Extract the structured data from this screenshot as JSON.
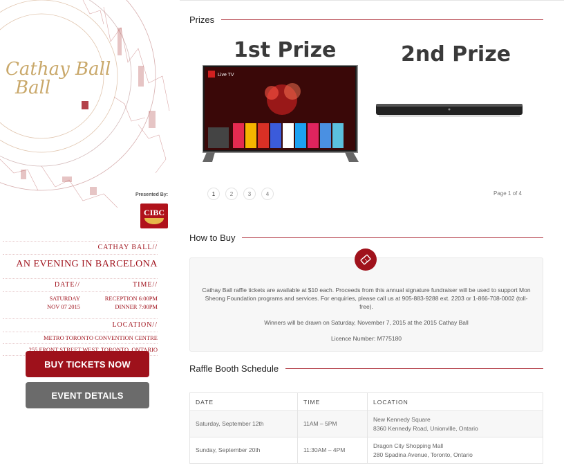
{
  "sidebar": {
    "logo_text": "Cathay Ball",
    "presented_by": "Presented By:",
    "sponsor": "CIBC",
    "event_label": "CATHAY BALL//",
    "tagline": "AN EVENING IN BARCELONA",
    "date_label": "DATE//",
    "time_label": "TIME//",
    "date_line1": "SATURDAY",
    "date_line2": "NOV 07 2015",
    "time_line1": "RECEPTION 6:00PM",
    "time_line2": "DINNER 7:00PM",
    "location_label": "LOCATION//",
    "location_line1": "METRO TORONTO CONVENTION CENTRE",
    "location_line2": "255 FRONT STREET WEST, TORONTO, ONTARIO",
    "buy_button": "BUY TICKETS NOW",
    "details_button": "EVENT DETAILS"
  },
  "prizes": {
    "heading": "Prizes",
    "first_title": "1st Prize",
    "second_title": "2nd Prize",
    "tv_label": "Live TV",
    "pages": [
      "1",
      "2",
      "3",
      "4"
    ],
    "page_indicator": "Page 1 of 4"
  },
  "how_to_buy": {
    "heading": "How to Buy",
    "paragraph1": "Cathay Ball raffle tickets are available at $10 each. Proceeds from this annual signature fundraiser will be used to support Mon Sheong Foundation programs and services. For enquiries, please call us at 905-883-9288 ext. 2203 or 1-866-708-0002 (toll-free).",
    "paragraph2": "Winners will be drawn on Saturday, November 7, 2015 at the 2015 Cathay Ball",
    "paragraph3": "Licence Number: M775180",
    "icon": "ticket-icon"
  },
  "schedule": {
    "heading": "Raffle Booth Schedule",
    "columns": [
      "DATE",
      "TIME",
      "LOCATION"
    ],
    "rows": [
      {
        "date": "Saturday, September 12th",
        "time": "11AM – 5PM",
        "loc1": "New Kennedy Square",
        "loc2": "8360 Kennedy Road, Unionville, Ontario"
      },
      {
        "date": "Sunday, September 20th",
        "time": "11:30AM – 4PM",
        "loc1": "Dragon City Shopping Mall",
        "loc2": "280 Spadina Avenue, Toronto, Ontario"
      }
    ]
  },
  "colors": {
    "accent": "#9e111b",
    "grey_button": "#6b6b6b",
    "rule": "#b23a44"
  }
}
